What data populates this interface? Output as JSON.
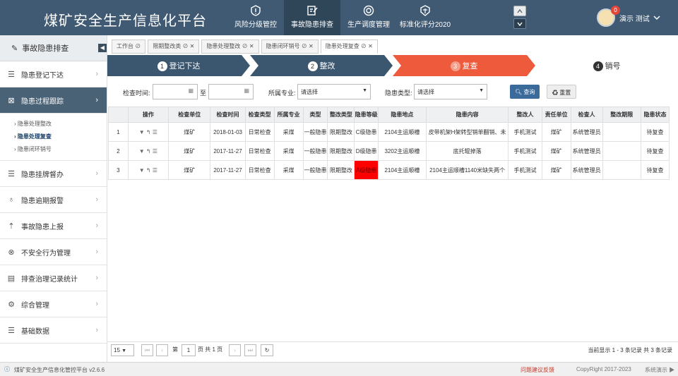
{
  "header": {
    "title": "煤矿安全生产信息化平台",
    "nav": [
      {
        "label": "风险分级管控",
        "icon": "shield-warning-icon"
      },
      {
        "label": "事故隐患排查",
        "icon": "edit-doc-icon"
      },
      {
        "label": "生产调度管理",
        "icon": "gauge-icon"
      },
      {
        "label": "标准化评分2020",
        "icon": "quality-badge-icon"
      }
    ],
    "user": "演示 测试",
    "badge": "0"
  },
  "sidebar": {
    "header": "事故隐患排查",
    "items": [
      {
        "label": "隐患登记下达",
        "icon": "list-icon"
      },
      {
        "label": "隐患过程跟踪",
        "icon": "chart-icon"
      },
      {
        "label": "隐患挂牌督办",
        "icon": "list-icon"
      },
      {
        "label": "隐患逾期报警",
        "icon": "alarm-icon"
      },
      {
        "label": "事故隐患上报",
        "icon": "report-icon"
      },
      {
        "label": "不安全行为管理",
        "icon": "close-circle-icon"
      },
      {
        "label": "排查治理记录统计",
        "icon": "table-icon"
      },
      {
        "label": "综合管理",
        "icon": "manage-icon"
      },
      {
        "label": "基础数据",
        "icon": "list-icon"
      }
    ],
    "subitems": [
      "隐患处理整改",
      "隐患处理复查",
      "隐患闭环销号"
    ]
  },
  "tabs": [
    "工作台 ⊘",
    "限期整改类 ⊘ ✕",
    "隐患处理整改 ⊘ ✕",
    "隐患闭环销号 ⊘ ✕",
    "隐患处理复查 ⊘ ✕"
  ],
  "steps": [
    {
      "n": "1",
      "label": "登记下达"
    },
    {
      "n": "2",
      "label": "整改"
    },
    {
      "n": "3",
      "label": "复查"
    },
    {
      "n": "4",
      "label": "销号"
    }
  ],
  "filter": {
    "time_label": "检查时间:",
    "to": "至",
    "major_label": "所属专业:",
    "major_value": "请选择",
    "type_label": "隐患类型:",
    "type_value": "请选择",
    "search": "查询",
    "reset": "重置"
  },
  "table": {
    "columns": [
      "操作",
      "检查单位",
      "检查时间",
      "检查类型",
      "所属专业",
      "类型",
      "整改类型",
      "隐患等级",
      "隐患地点",
      "隐患内容",
      "整改人",
      "责任单位",
      "检查人",
      "整改期限",
      "隐患状态"
    ],
    "rows": [
      [
        "1",
        "▼ ↰ ☰",
        "煤矿",
        "2018-01-03",
        "日常检查",
        "采煤",
        "一般隐患",
        "限期整改",
        "C级隐患",
        "2104主运顺槽",
        "皮带机架H架转型销单翻销、未",
        "手机测试",
        "煤矿",
        "系统管理员",
        "",
        "待复查"
      ],
      [
        "2",
        "▼ ↰ ☰",
        "煤矿",
        "2017-11-27",
        "日常检查",
        "采煤",
        "一般隐患",
        "限期整改",
        "D级隐患",
        "3202主运顺槽",
        "底托辊掉落",
        "手机测试",
        "煤矿",
        "系统管理员",
        "",
        "待复查"
      ],
      [
        "3",
        "▼ ↰ ☰",
        "煤矿",
        "2017-11-27",
        "日常检查",
        "采煤",
        "一般隐患",
        "限期整改",
        "A级隐患",
        "2104主运顺槽",
        "2104主运顺槽1140米缺失两个",
        "手机测试",
        "煤矿",
        "系统管理员",
        "",
        "待复查"
      ]
    ]
  },
  "pager": {
    "size": "15",
    "page_pre": "第",
    "page": "1",
    "page_post": "页 共 1 页",
    "info": "当前显示 1 - 3 条记录 共 3 条记录"
  },
  "footer": {
    "left": "煤矿安全生产信息化管控平台 v2.6.6",
    "feedback": "问题建议反馈",
    "copyright": "CopyRight 2017-2023",
    "demo": "系统演示 ▶"
  },
  "colors": {
    "header": "#3f5a72",
    "active_step": "#ee5a3c",
    "step": "#3b5770",
    "a_level": "#ff0000"
  }
}
